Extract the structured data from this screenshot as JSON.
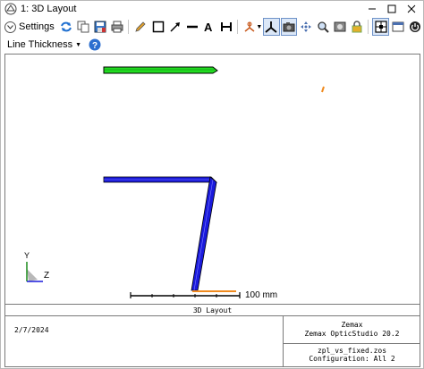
{
  "window": {
    "title": "1: 3D Layout"
  },
  "toolbar": {
    "settings_label": "Settings",
    "line_thickness_label": "Line Thickness"
  },
  "canvas": {
    "scale_label": "100 mm",
    "axis_y": "Y",
    "axis_z": "Z"
  },
  "footer": {
    "title": "3D Layout",
    "date": "2/7/2024",
    "company": "Zemax",
    "product": "Zemax OpticStudio 20.2",
    "filename": "zpl_vs_fixed.zos",
    "configuration": "Configuration: All 2"
  },
  "colors": {
    "green_ray": "#22dd22",
    "blue_ray": "#1a1adc",
    "orange_ray": "#f08a1e",
    "accent": "#1e6fd0"
  }
}
